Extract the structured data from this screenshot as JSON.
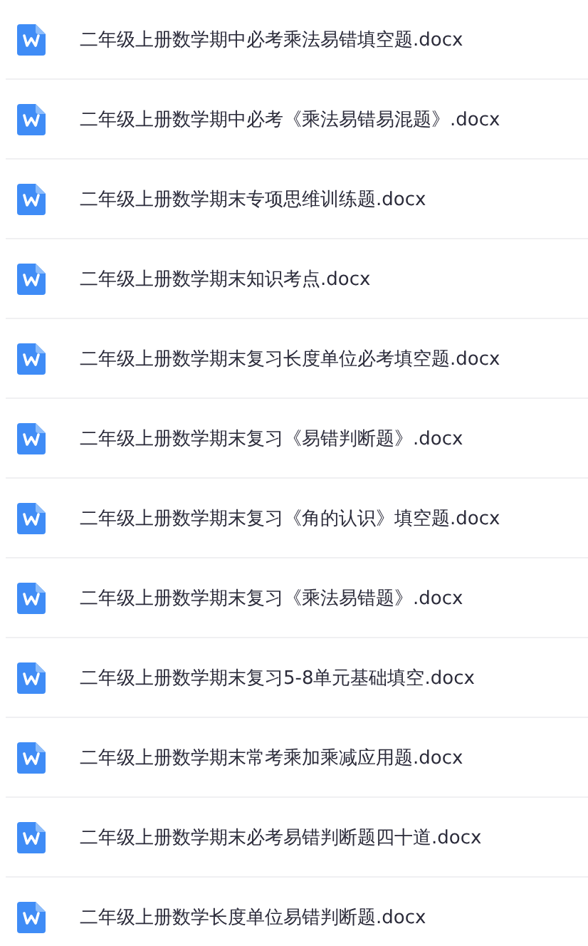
{
  "files": [
    {
      "name": "二年级上册数学期中必考乘法易错填空题.docx"
    },
    {
      "name": "二年级上册数学期中必考《乘法易错易混题》.docx"
    },
    {
      "name": "二年级上册数学期末专项思维训练题.docx"
    },
    {
      "name": "二年级上册数学期末知识考点.docx"
    },
    {
      "name": "二年级上册数学期末复习长度单位必考填空题.docx"
    },
    {
      "name": "二年级上册数学期末复习《易错判断题》.docx"
    },
    {
      "name": "二年级上册数学期末复习《角的认识》填空题.docx"
    },
    {
      "name": "二年级上册数学期末复习《乘法易错题》.docx"
    },
    {
      "name": "二年级上册数学期末复习5-8单元基础填空.docx"
    },
    {
      "name": "二年级上册数学期末常考乘加乘减应用题.docx"
    },
    {
      "name": "二年级上册数学期末必考易错判断题四十道.docx"
    },
    {
      "name": "二年级上册数学长度单位易错判断题.docx"
    }
  ]
}
